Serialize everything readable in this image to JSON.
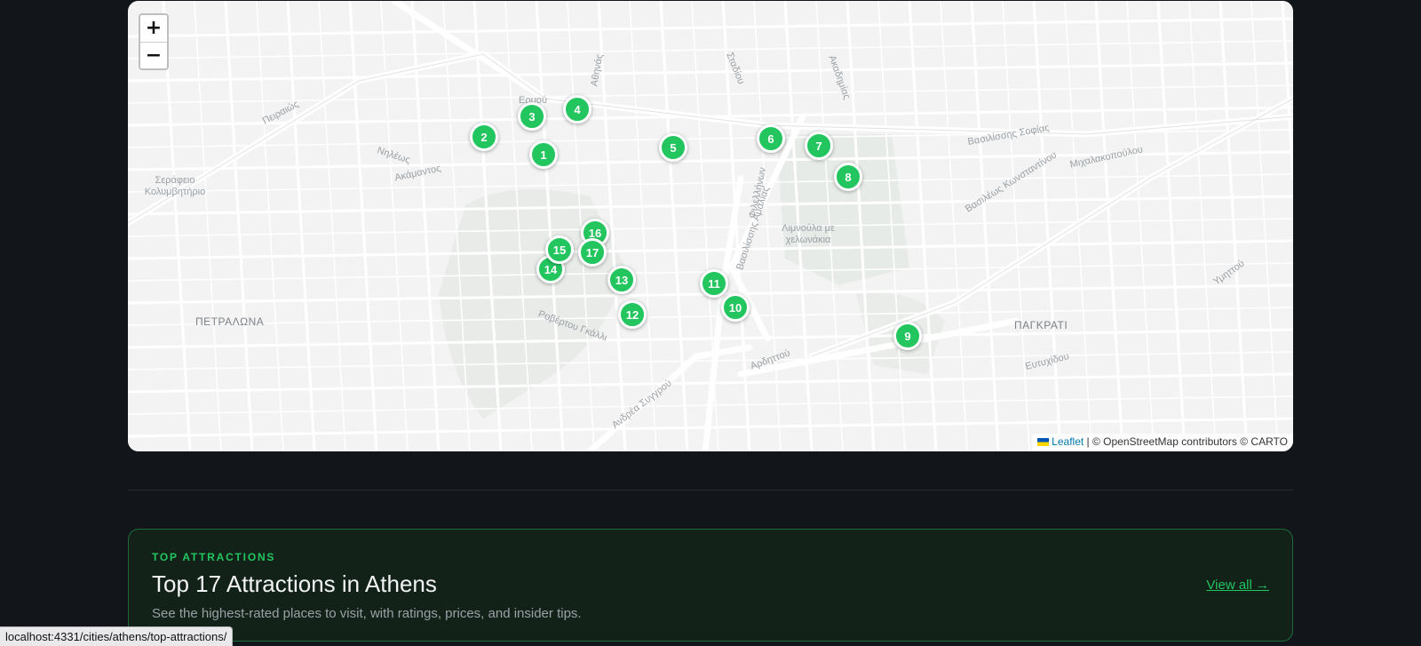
{
  "map": {
    "zoom_in_label": "+",
    "zoom_out_label": "−",
    "marker_color": "#22c55e",
    "markers": [
      "1",
      "2",
      "3",
      "4",
      "5",
      "6",
      "7",
      "8",
      "9",
      "10",
      "11",
      "12",
      "13",
      "14",
      "15",
      "16",
      "17"
    ],
    "labels": {
      "serafeio": "Σεράφειο Κολυμβητήριο",
      "petralona": "ΠΕΤΡΑΛΩΝΑ",
      "pagkrati": "ΠΑΓΚΡΑΤΙ",
      "limnoula": "Λιμνούλα με χελωνάκια",
      "pireos": "Πειραιώς",
      "ermou": "Ερμού",
      "athinas": "Αθηνάς",
      "stadiou": "Σταδίου",
      "akadimias": "Ακαδημίας",
      "vas_sofias": "Βασιλίσσης Σοφίας",
      "vas_konstantinou": "Βασιλέως Κωνσταντίνου",
      "michalakopoulou": "Μιχαλακοπούλου",
      "amalias": "Βασιλίσσης Αμαλίας",
      "filellinon": "Φιλελλήνων",
      "ardittou": "Αρδηττού",
      "syngrou": "Ανδρέα Συγγρού",
      "rovertou_galli": "Ροβέρτου Γκάλλι",
      "ymittou": "Υμηττού",
      "eftychidou": "Ευτυχίδου",
      "nileos": "Νηλέως",
      "akamantos": "Ακάμαντος"
    },
    "attribution": {
      "leaflet": "Leaflet",
      "rest": "| © OpenStreetMap contributors © CARTO"
    }
  },
  "card": {
    "eyebrow": "TOP ATTRACTIONS",
    "title": "Top 17 Attractions in Athens",
    "description": "See the highest-rated places to visit, with ratings, prices, and insider tips.",
    "view_all": "View all →",
    "accent_color": "#22c55e"
  },
  "status_bar": {
    "url": "localhost:4331/cities/athens/top-attractions/"
  }
}
